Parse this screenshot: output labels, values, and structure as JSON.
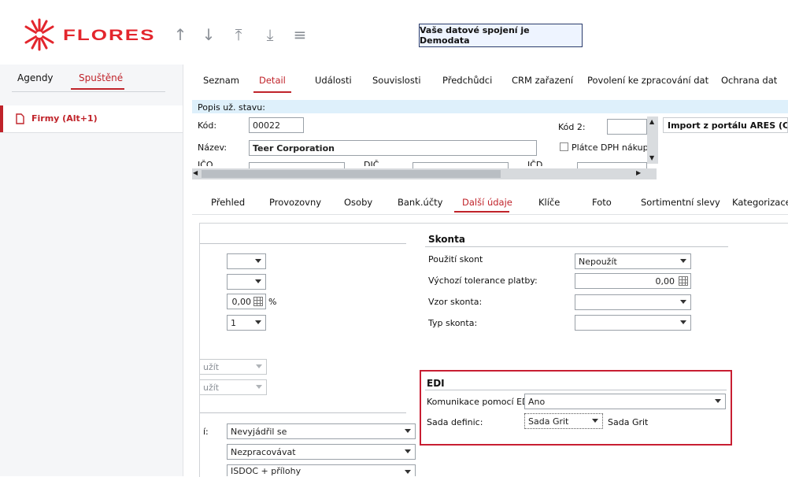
{
  "header": {
    "logo_text": "FLORES",
    "status_message": "Vaše datové spojení je Demodata"
  },
  "sidebar": {
    "tabs": [
      "Agendy",
      "Spuštěné"
    ],
    "active_tab": "Spuštěné",
    "items": [
      {
        "label": "Firmy (Alt+1)"
      }
    ]
  },
  "main_tabs": [
    "Seznam",
    "Detail",
    "Události",
    "Souvislosti",
    "Předchůdci",
    "CRM zařazení",
    "Povolení ke zpracování dat",
    "Ochrana dat"
  ],
  "active_main_tab": "Detail",
  "record": {
    "status_label": "Popis už. stavu:",
    "kod_label": "Kód:",
    "kod_value": "00022",
    "kod2_label": "Kód 2:",
    "nazev_label": "Název:",
    "nazev_value": "Teer Corporation",
    "platce_label": "Plátce DPH nákup",
    "ico_label": "IČO",
    "dic_label": "DIČ",
    "icd_label": "IČD",
    "ares_button": "Import z portálu ARES (CZ)"
  },
  "sub_tabs": [
    "Přehled",
    "Provozovny",
    "Osoby",
    "Bank.účty",
    "Další údaje",
    "Klíče",
    "Foto",
    "Sortimentní slevy",
    "Kategorizace"
  ],
  "active_sub_tab": "Další údaje",
  "left_fields": {
    "percent_value": "0,00",
    "percent_unit": "%",
    "number_value": "1",
    "disabled_1": "užít",
    "disabled_2": "užít",
    "partial_label": "í:",
    "select_1": "Nevyjádřil se",
    "select_2": "Nezpracovávat",
    "select_3": "ISDOC + přílohy"
  },
  "skonta": {
    "title": "Skonta",
    "use_label": "Použití skont",
    "use_value": "Nepoužít",
    "tolerance_label": "Výchozí tolerance platby:",
    "tolerance_value": "0,00",
    "pattern_label": "Vzor skonta:",
    "type_label": "Typ skonta:"
  },
  "edi": {
    "title": "EDI",
    "comm_label": "Komunikace pomocí EDI:",
    "comm_value": "Ano",
    "set_label": "Sada definic:",
    "set_value": "Sada Grit",
    "set_display": "Sada Grit"
  }
}
